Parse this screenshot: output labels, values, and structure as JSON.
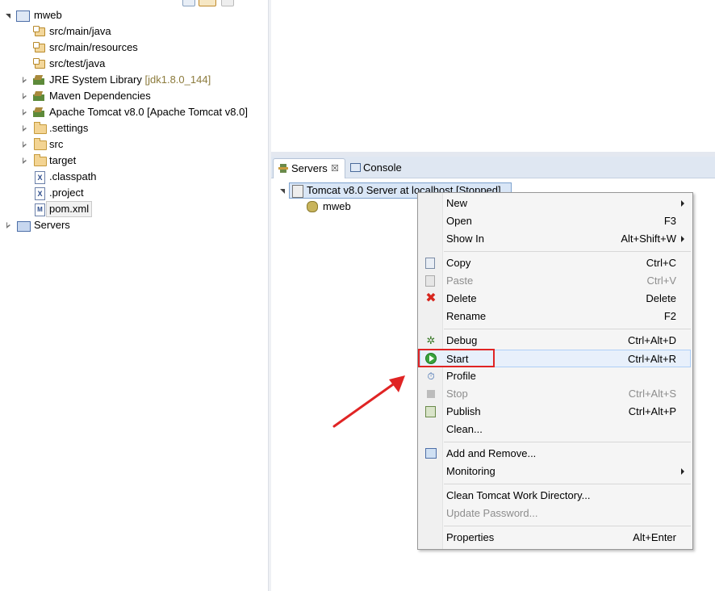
{
  "explorer": {
    "items": [
      {
        "label": "mweb",
        "twisty": "down",
        "icon": "project-icon"
      },
      {
        "label": "src/main/java",
        "icon": "package-folder-icon"
      },
      {
        "label": "src/main/resources",
        "icon": "package-folder-icon"
      },
      {
        "label": "src/test/java",
        "icon": "package-folder-icon"
      },
      {
        "label": "JRE System Library",
        "suffix": "[jdk1.8.0_144]",
        "twisty": "right",
        "icon": "library-icon"
      },
      {
        "label": "Maven Dependencies",
        "twisty": "right",
        "icon": "library-icon"
      },
      {
        "label": "Apache Tomcat v8.0 [Apache Tomcat v8.0]",
        "twisty": "right",
        "icon": "library-icon"
      },
      {
        "label": ".settings",
        "twisty": "right",
        "icon": "folder-icon"
      },
      {
        "label": "src",
        "twisty": "right",
        "icon": "folder-icon"
      },
      {
        "label": "target",
        "twisty": "right",
        "icon": "folder-icon"
      },
      {
        "label": ".classpath",
        "icon": "xml-file-icon",
        "glyph": "X"
      },
      {
        "label": ".project",
        "icon": "xml-file-icon",
        "glyph": "X"
      },
      {
        "label": "pom.xml",
        "icon": "maven-file-icon",
        "glyph": "M"
      },
      {
        "label": "Servers",
        "twisty": "right",
        "icon": "servers-folder-icon"
      }
    ]
  },
  "view": {
    "tabs": [
      {
        "label": "Servers",
        "close": "☒"
      },
      {
        "label": "Console"
      }
    ],
    "server": {
      "label": "Tomcat v8.0 Server at localhost  [Stopped]"
    },
    "module": {
      "label": "mweb"
    }
  },
  "context_menu": {
    "items": [
      {
        "label": "New",
        "submenu": true
      },
      {
        "label": "Open",
        "shortcut": "F3"
      },
      {
        "label": "Show In",
        "shortcut": "Alt+Shift+W",
        "submenu": true
      },
      {
        "label": "Copy",
        "shortcut": "Ctrl+C",
        "icon": "copy-icon"
      },
      {
        "label": "Paste",
        "shortcut": "Ctrl+V",
        "icon": "paste-icon",
        "disabled": true
      },
      {
        "label": "Delete",
        "shortcut": "Delete",
        "icon": "delete-icon"
      },
      {
        "label": "Rename",
        "shortcut": "F2"
      },
      {
        "label": "Debug",
        "shortcut": "Ctrl+Alt+D",
        "icon": "debug-icon"
      },
      {
        "label": "Start",
        "shortcut": "Ctrl+Alt+R",
        "icon": "start-icon",
        "hover": true
      },
      {
        "label": "Profile",
        "icon": "profile-icon"
      },
      {
        "label": "Stop",
        "shortcut": "Ctrl+Alt+S",
        "icon": "stop-icon",
        "disabled": true
      },
      {
        "label": "Publish",
        "shortcut": "Ctrl+Alt+P",
        "icon": "publish-icon"
      },
      {
        "label": "Clean..."
      },
      {
        "label": "Add and Remove...",
        "icon": "add-remove-icon"
      },
      {
        "label": "Monitoring",
        "submenu": true
      },
      {
        "label": "Clean Tomcat Work Directory..."
      },
      {
        "label": "Update Password...",
        "disabled": true
      },
      {
        "label": "Properties",
        "shortcut": "Alt+Enter"
      }
    ]
  },
  "colors": {
    "highlight_box": "#e02424",
    "arrow": "#e02424",
    "selection": "#d9e6f6",
    "tabbar": "#dfe7f2"
  }
}
